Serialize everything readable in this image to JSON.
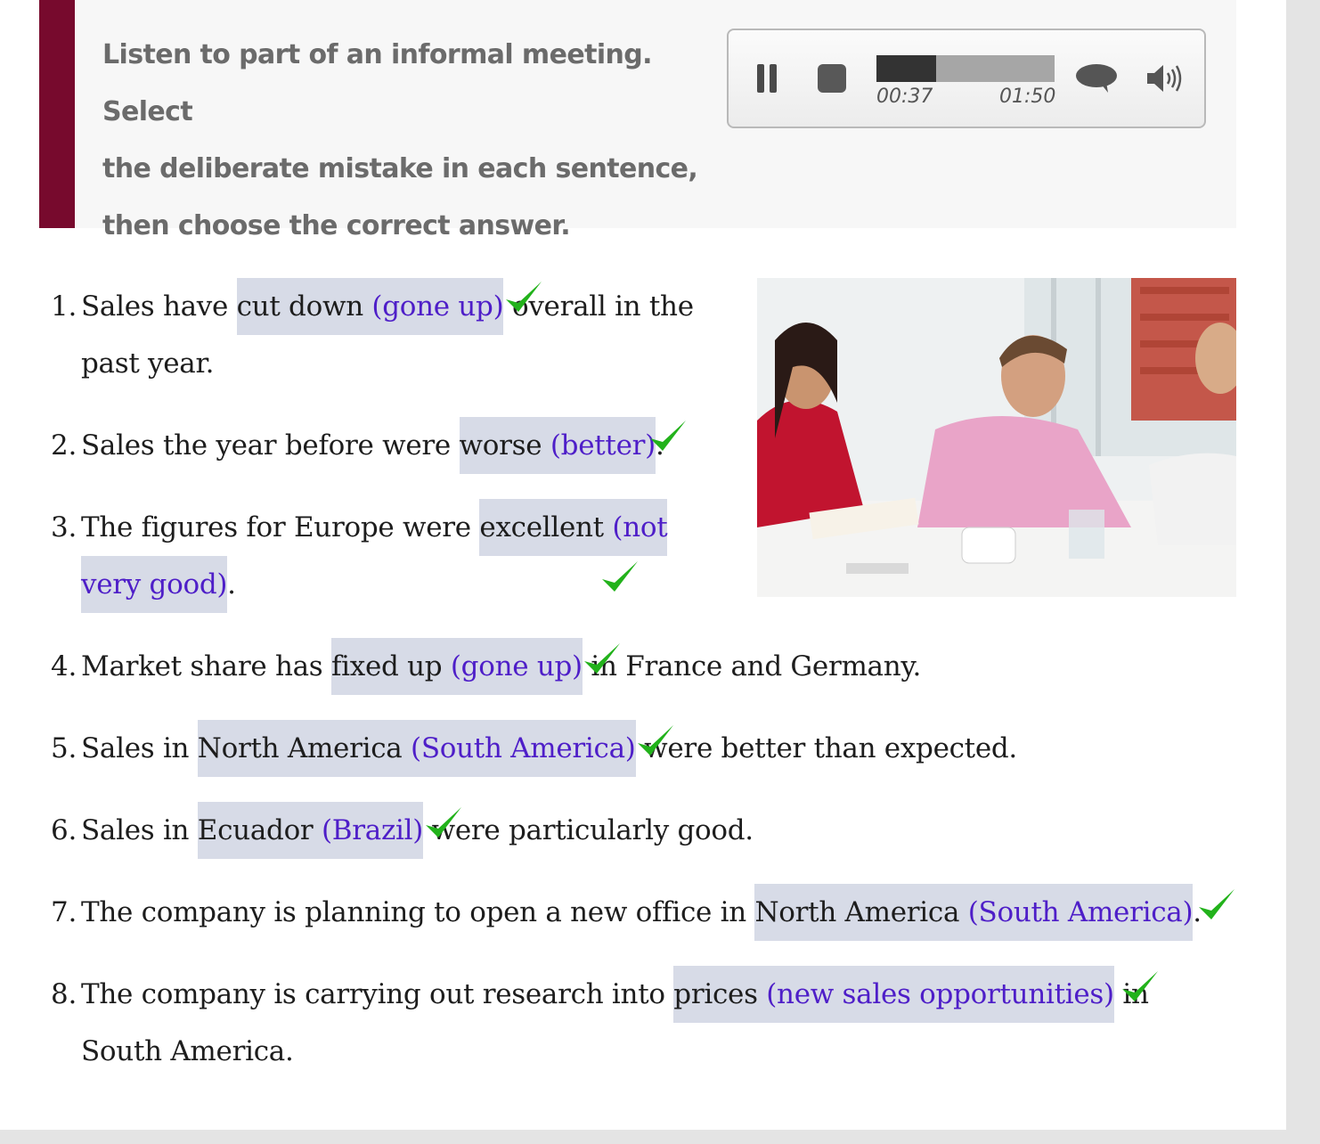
{
  "instruction": {
    "line1": "Listen to part of an informal meeting. Select",
    "line2": "the deliberate mistake in each sentence,",
    "line3": "then choose the correct answer."
  },
  "player": {
    "elapsed": "00:37",
    "total": "01:50",
    "progress_fraction": 0.336,
    "pause_icon": "pause-icon",
    "stop_icon": "stop-icon",
    "transcript_icon": "speech-bubble-icon",
    "volume_icon": "speaker-icon"
  },
  "colors": {
    "accent": "#770a2d",
    "highlight": "#d7dbe7",
    "correction": "#4e1ec8",
    "tick": "#22b21b"
  },
  "questions": [
    {
      "num": "1.",
      "before": "Sales have ",
      "mistake": "cut down",
      "correction": "(gone up)",
      "after": " overall in the",
      "after2": "past year."
    },
    {
      "num": "2.",
      "before": "Sales the year before were ",
      "mistake": "worse",
      "correction": "(better)",
      "after": "."
    },
    {
      "num": "3.",
      "before": "The figures for Europe were ",
      "mistake": "excellent",
      "correction1": "(not",
      "correction2": "very good)",
      "after": "."
    },
    {
      "num": "4.",
      "before": "Market share has ",
      "mistake": "fixed up",
      "correction": "(gone up)",
      "after": " in France and Germany."
    },
    {
      "num": "5.",
      "before": "Sales in ",
      "mistake": "North America",
      "correction": "(South America)",
      "after": " were better than expected."
    },
    {
      "num": "6.",
      "before": "Sales in ",
      "mistake": "Ecuador",
      "correction": "(Brazil)",
      "after": " were particularly good."
    },
    {
      "num": "7.",
      "before": "The company is planning to open a new office in ",
      "mistake": "North America",
      "correction": "(South America)",
      "after": "."
    },
    {
      "num": "8.",
      "before": "The company is carrying out research into ",
      "mistake": "prices",
      "correction": "(new sales opportunities)",
      "after": " in",
      "after2": "South America."
    }
  ],
  "photo": {
    "icon": "meeting-photo"
  }
}
